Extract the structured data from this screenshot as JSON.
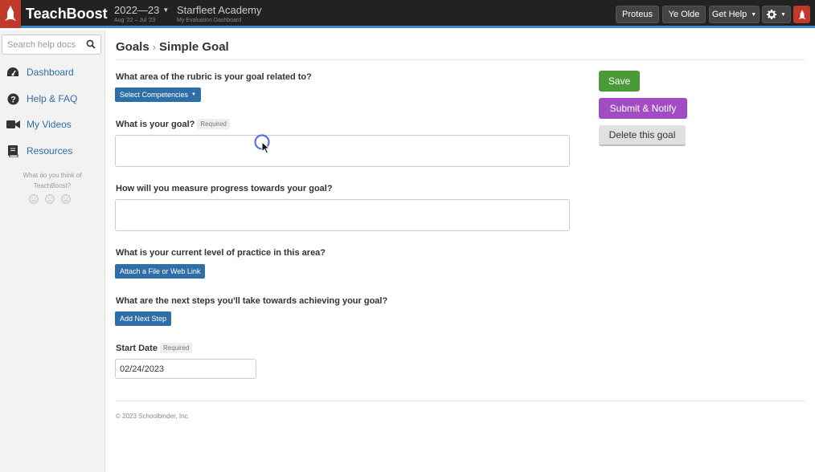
{
  "topbar": {
    "brand": "TeachBoost",
    "year": {
      "label": "2022—23",
      "range": "Aug '22 – Jul '23"
    },
    "school": {
      "name": "Starfleet Academy",
      "subtitle": "My Evaluation Dashboard"
    },
    "buttons": {
      "proteus": "Proteus",
      "ye_olde": "Ye Olde",
      "get_help": "Get Help"
    }
  },
  "sidebar": {
    "search": {
      "placeholder": "Search help docs"
    },
    "items": [
      {
        "label": "Dashboard",
        "icon": "dashboard-icon"
      },
      {
        "label": "Help & FAQ",
        "icon": "question-icon"
      },
      {
        "label": "My Videos",
        "icon": "video-camera-icon"
      },
      {
        "label": "Resources",
        "icon": "book-icon"
      }
    ],
    "feedback": {
      "line1": "What do you think of",
      "line2": "TeachBoost?"
    }
  },
  "main": {
    "breadcrumb": {
      "parent": "Goals",
      "separator": "›",
      "current": "Simple Goal"
    },
    "questions": {
      "rubric": "What area of the rubric is your goal related to?",
      "goal": "What is your goal?",
      "measure": "How will you measure progress towards your goal?",
      "practice": "What is your current level of practice in this area?",
      "next_steps": "What are the next steps you'll take towards achieving your goal?",
      "start_date": "Start Date"
    },
    "required_label": "Required",
    "buttons": {
      "select_competencies": "Select Competencies",
      "attach": "Attach a File or Web Link",
      "add_next_step": "Add Next Step"
    },
    "start_date_value": "02/24/2023",
    "actions": {
      "save": "Save",
      "submit": "Submit & Notify",
      "delete": "Delete this goal"
    },
    "footer": "© 2023 Schoolbinder, Inc."
  },
  "colors": {
    "topbar": "#222222",
    "topbar_accent": "#3a8ad0",
    "brand_red": "#c0392b",
    "link_blue": "#2f6fa8",
    "save_green": "#4a9a3a",
    "submit_purple": "#a24cc4"
  }
}
